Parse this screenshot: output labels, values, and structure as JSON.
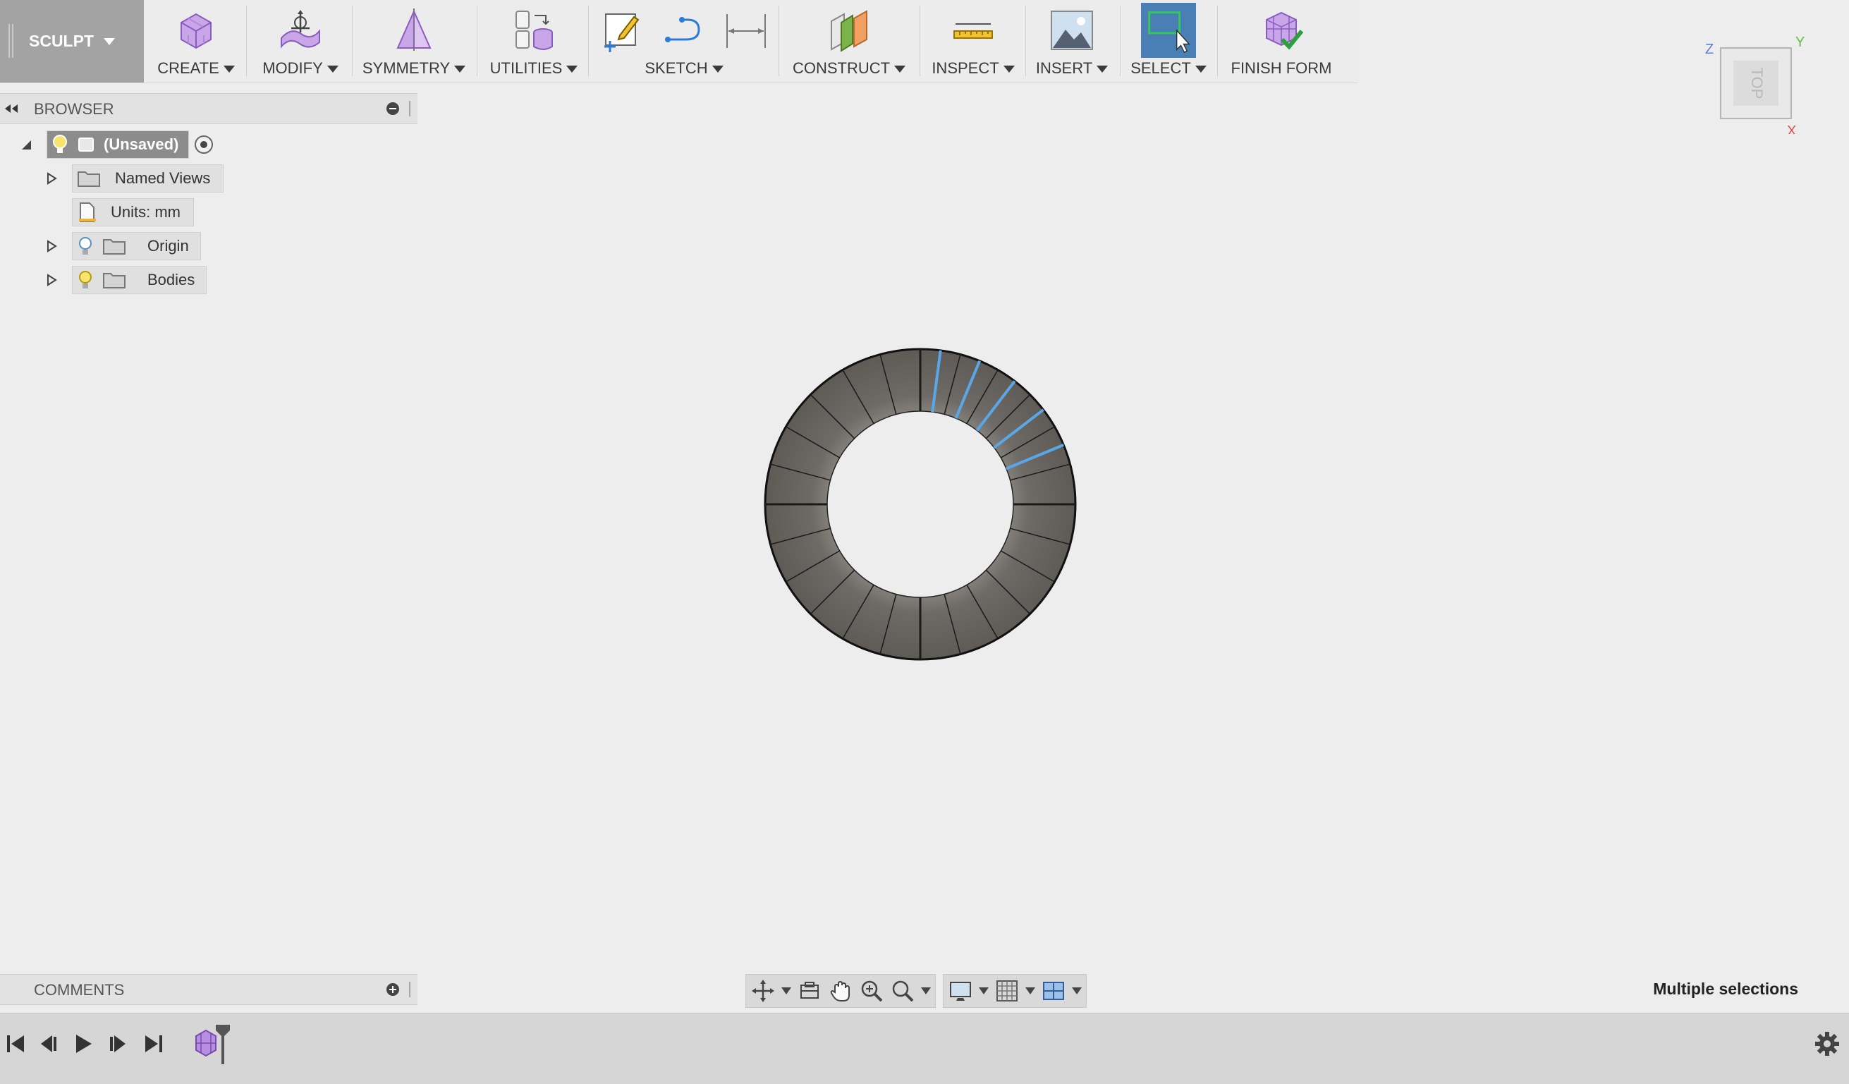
{
  "workspace": {
    "label": "SCULPT"
  },
  "toolbar": {
    "groups": [
      {
        "id": "create",
        "label": "CREATE"
      },
      {
        "id": "modify",
        "label": "MODIFY"
      },
      {
        "id": "symmetry",
        "label": "SYMMETRY"
      },
      {
        "id": "utilities",
        "label": "UTILITIES"
      },
      {
        "id": "sketch",
        "label": "SKETCH"
      },
      {
        "id": "construct",
        "label": "CONSTRUCT"
      },
      {
        "id": "inspect",
        "label": "INSPECT"
      },
      {
        "id": "insert",
        "label": "INSERT"
      },
      {
        "id": "select",
        "label": "SELECT"
      },
      {
        "id": "finish_form",
        "label": "FINISH FORM"
      }
    ]
  },
  "browser": {
    "title": "BROWSER",
    "root": {
      "label": "(Unsaved)"
    },
    "items": [
      {
        "label": "Named Views",
        "icon": "folder-icon"
      },
      {
        "label": "Units: mm",
        "icon": "document-icon"
      },
      {
        "label": "Origin",
        "icon": "folder-icon"
      },
      {
        "label": "Bodies",
        "icon": "folder-icon"
      }
    ]
  },
  "comments": {
    "title": "COMMENTS"
  },
  "viewcube": {
    "face": "TOP",
    "axes": {
      "x": "X",
      "y": "Y",
      "z": "Z"
    }
  },
  "status": {
    "text": "Multiple selections"
  },
  "viewport": {
    "model": "ring-tsurface",
    "segments": 24,
    "selected_edges": 5,
    "colors": {
      "body": "#6b6762",
      "edge": "#1a1a1a",
      "selected": "#5aa7e8"
    }
  },
  "colors": {
    "select_active": "#4a7fb5",
    "background": "#ededed"
  }
}
